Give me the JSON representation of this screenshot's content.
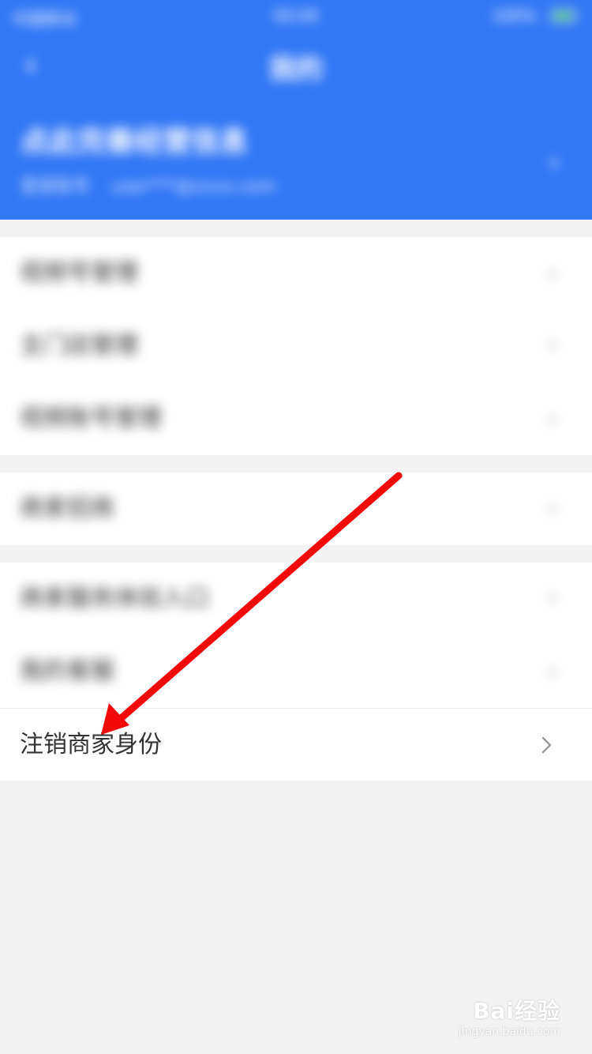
{
  "status_bar": {
    "carrier": "中国移动",
    "time": "00:00",
    "battery": "100%"
  },
  "nav": {
    "title": "我的"
  },
  "profile": {
    "shop_name": "点此完善经营信息",
    "account_label": "登录账号",
    "account_value": "user***@xxxx.com"
  },
  "groups": [
    {
      "items": [
        {
          "label": "视频号管理"
        },
        {
          "label": "主门店管理"
        },
        {
          "label": "视频账号管理"
        }
      ]
    },
    {
      "items": [
        {
          "label": "商家招商"
        }
      ]
    },
    {
      "items": [
        {
          "label": "商家服务体验入口"
        },
        {
          "label": "我的客服"
        },
        {
          "label": "注销商家身份"
        }
      ]
    }
  ],
  "annotation": {
    "color": "#f20a0a"
  },
  "watermark": {
    "main": "Bai经验",
    "sub": "jingyan.baidu.com"
  },
  "colors": {
    "header": "#3478f6",
    "background": "#f3f3f3",
    "text": "#333333",
    "chevron": "#9a9a9a"
  }
}
